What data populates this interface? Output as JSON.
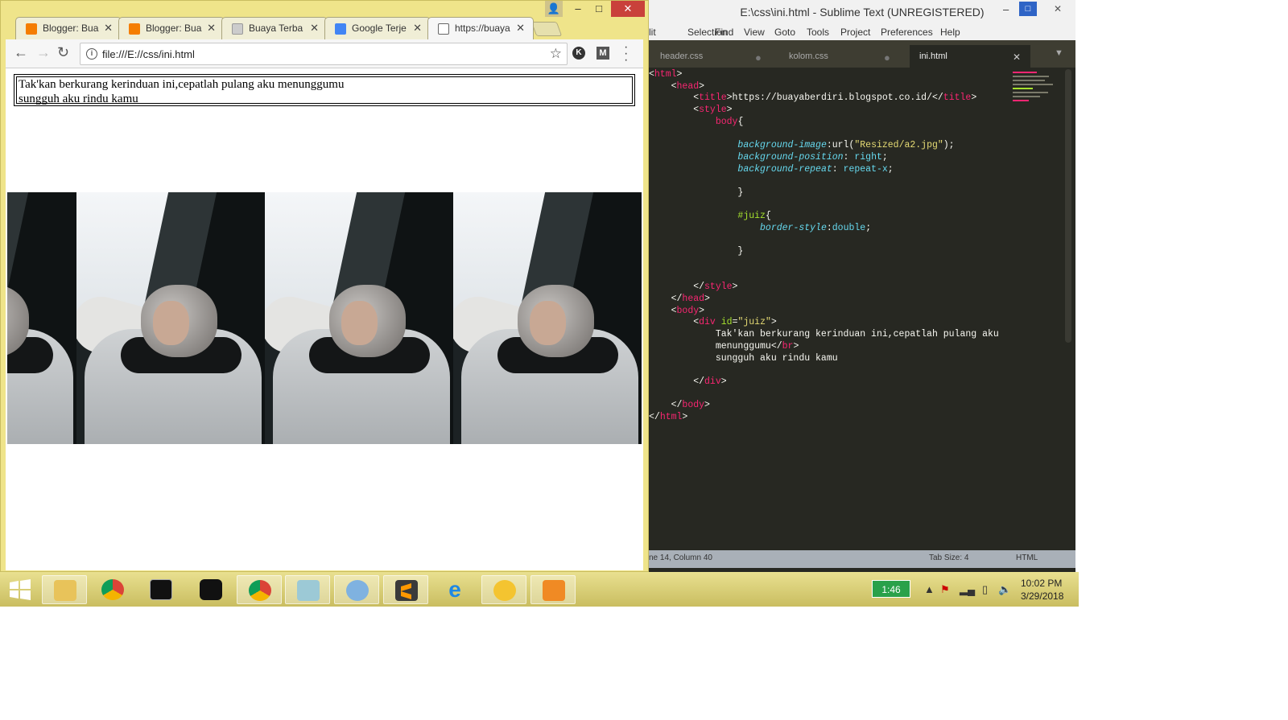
{
  "browser": {
    "tabs": [
      {
        "title": "Blogger: Bua",
        "favicon_color": "#f57d00"
      },
      {
        "title": "Blogger: Bua",
        "favicon_color": "#f57d00"
      },
      {
        "title": "Buaya Terba",
        "favicon_color": "#bbbbbb"
      },
      {
        "title": "Google Terje",
        "favicon_color": "#4285f4"
      },
      {
        "title": "https://buaya",
        "favicon_color": "#ffffff"
      }
    ],
    "tab_close": "✕",
    "address": "file:///E://css/ini.html",
    "window_controls": {
      "user": "👤",
      "minimize": "–",
      "maximize": "□",
      "close": "✕"
    },
    "page": {
      "line1": "Tak'kan berkurang kerinduan ini,cepatlah pulang aku menunggumu",
      "line2": "sungguh aku rindu kamu"
    }
  },
  "editor": {
    "title": "E:\\css\\ini.html - Sublime Text (UNREGISTERED)",
    "menu": [
      "lit",
      "Selection",
      "Find",
      "View",
      "Goto",
      "Tools",
      "Project",
      "Preferences",
      "Help"
    ],
    "tabs": [
      {
        "name": "header.css",
        "active": false
      },
      {
        "name": "kolom.css",
        "active": false
      },
      {
        "name": "ini.html",
        "active": true
      }
    ],
    "code_lines": [
      [
        "<",
        "html",
        ">"
      ],
      [
        "    <",
        "head",
        ">"
      ],
      [
        "        <",
        "title",
        ">https://buayaberdiri.blogspot.co.id/</",
        "title",
        ">"
      ],
      [
        "        <",
        "style",
        ">"
      ],
      [
        "            ",
        "body",
        "{"
      ],
      [
        ""
      ],
      [
        "                ",
        "background-image",
        ":url(",
        "\"Resized/a2.jpg\"",
        ");"
      ],
      [
        "                ",
        "background-position",
        ": ",
        "right",
        ";"
      ],
      [
        "                ",
        "background-repeat",
        ": ",
        "repeat-x",
        ";"
      ],
      [
        ""
      ],
      [
        "                }"
      ],
      [
        ""
      ],
      [
        "                ",
        "#juiz",
        "{"
      ],
      [
        "                    ",
        "border-style",
        ":",
        "double",
        ";"
      ],
      [
        ""
      ],
      [
        "                }"
      ],
      [
        ""
      ],
      [
        ""
      ],
      [
        "        </",
        "style",
        ">"
      ],
      [
        "    </",
        "head",
        ">"
      ],
      [
        "    <",
        "body",
        ">"
      ],
      [
        "        <",
        "div",
        " ",
        "id",
        "=",
        "\"juiz\"",
        ">"
      ],
      [
        "            Tak'kan berkurang kerinduan ini,cepatlah pulang aku"
      ],
      [
        "            menunggumu</",
        "br",
        ">"
      ],
      [
        "            sungguh aku rindu kamu"
      ],
      [
        ""
      ],
      [
        "        </",
        "div",
        ">"
      ],
      [
        ""
      ],
      [
        "    </",
        "body",
        ">"
      ],
      [
        "</",
        "html",
        ">"
      ]
    ],
    "status": {
      "position": "ne 14, Column 40",
      "tab_size": "Tab Size: 4",
      "syntax": "HTML"
    }
  },
  "taskbar": {
    "battery": "1:46",
    "time": "10:02 PM",
    "date": "3/29/2018",
    "apps": [
      "start",
      "file-explorer",
      "chrome",
      "cmd",
      "garena",
      "chrome",
      "notepad",
      "paint",
      "sublime",
      "internet-explorer",
      "app",
      "media-player"
    ]
  }
}
